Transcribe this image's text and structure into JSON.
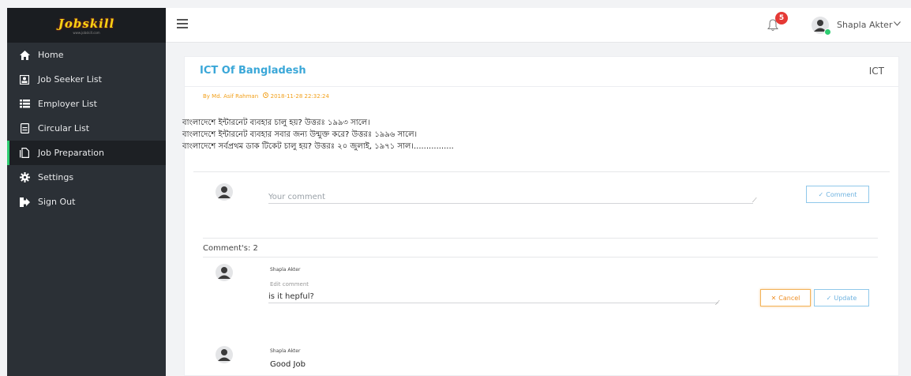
{
  "brand": {
    "logo_text": "Jobskill",
    "logo_sub": "www.jobskill.com"
  },
  "sidebar": {
    "items": [
      {
        "label": "Home",
        "icon": "home-icon"
      },
      {
        "label": "Job Seeker List",
        "icon": "id-card-icon"
      },
      {
        "label": "Employer List",
        "icon": "list-icon"
      },
      {
        "label": "Circular List",
        "icon": "document-icon"
      },
      {
        "label": "Job Preparation",
        "icon": "copy-icon",
        "active": true
      },
      {
        "label": "Settings",
        "icon": "gear-icon"
      },
      {
        "label": "Sign Out",
        "icon": "sign-out-icon"
      }
    ]
  },
  "topbar": {
    "notification_count": "5",
    "user_name": "Shapla Akter",
    "chevron": "v"
  },
  "post": {
    "title": "ICT Of Bangladesh",
    "category": "ICT",
    "author": "By Md. Asif Rahman",
    "timestamp": "2018-11-28 22:32:24",
    "lines": [
      "বাংলাদেশে ইন্টারনেট ব্যবহার চালু হয়? উত্তরঃ ১৯৯৩ সালে।",
      "বাংলাদেশে ইন্টারনেট ব্যবহার সবার জন্য উন্মুক্ত করে? উত্তরঃ ১৯৯৬ সালে।",
      "বাংলাদেশে সর্বপ্রথম ডাক টিকেট চালু হয়? উত্তরঃ ২০ জুলাই, ১৯৭১ সাল।................"
    ]
  },
  "comment_form": {
    "placeholder": "Your comment",
    "submit_label": "Comment"
  },
  "comments": {
    "count_label": "Comment's: 2",
    "items": [
      {
        "author": "Shapla Akter",
        "edit_label": "Edit comment",
        "text": "is it hepful?",
        "cancel_label": "Cancel",
        "update_label": "Update"
      },
      {
        "author": "Shapla Akter",
        "text": "Good Job"
      }
    ]
  },
  "colors": {
    "accent": "#3aa7d8",
    "meta": "#f2a01b",
    "active_bar": "#2ecc71",
    "badge": "#e53935"
  }
}
